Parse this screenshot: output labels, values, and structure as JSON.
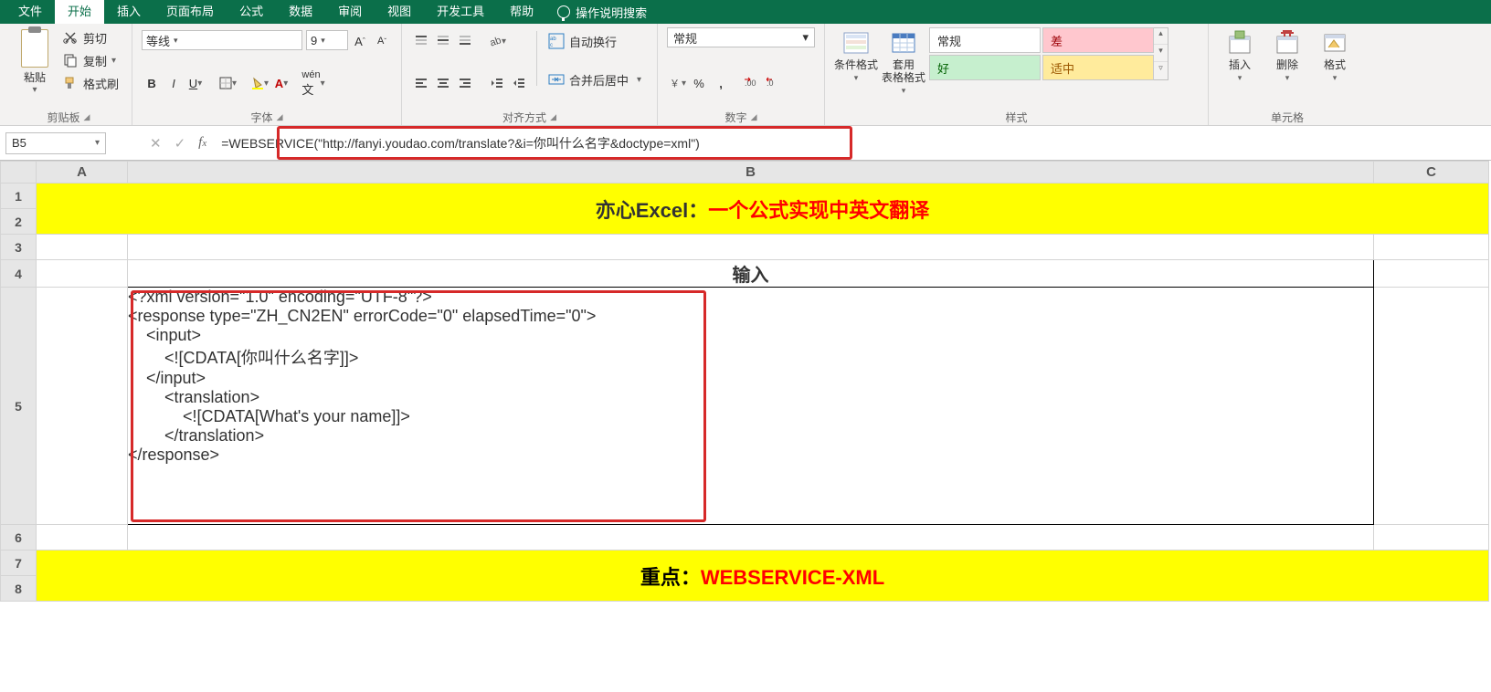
{
  "menu": {
    "items": [
      "文件",
      "开始",
      "插入",
      "页面布局",
      "公式",
      "数据",
      "审阅",
      "视图",
      "开发工具",
      "帮助"
    ],
    "active": 1,
    "tell_me": "操作说明搜索"
  },
  "ribbon": {
    "clipboard": {
      "paste": "粘贴",
      "cut": "剪切",
      "copy": "复制",
      "format_painter": "格式刷",
      "caption": "剪贴板"
    },
    "font": {
      "name": "等线",
      "size": "9",
      "caption": "字体"
    },
    "alignment": {
      "wrap": "自动换行",
      "merge": "合并后居中",
      "caption": "对齐方式"
    },
    "number": {
      "format": "常规",
      "caption": "数字"
    },
    "styles": {
      "cond": "条件格式",
      "table": "套用\n表格格式",
      "normal": "常规",
      "bad": "差",
      "good": "好",
      "neutral": "适中",
      "caption": "样式"
    },
    "cells": {
      "insert": "插入",
      "delete": "删除",
      "format": "格式",
      "caption": "单元格"
    }
  },
  "formula_bar": {
    "name": "B5",
    "formula": "=WEBSERVICE(\"http://fanyi.youdao.com/translate?&i=你叫什么名字&doctype=xml\")"
  },
  "columns": [
    "A",
    "B",
    "C"
  ],
  "rows": [
    "1",
    "2",
    "3",
    "4",
    "5",
    "6",
    "7",
    "8"
  ],
  "sheet": {
    "title_prefix": "亦心Excel：",
    "title_red": "一个公式实现中英文翻译",
    "header_b4": "输入",
    "xml_text": "<?xml version=\"1.0\" encoding=\"UTF-8\"?>\n<response type=\"ZH_CN2EN\" errorCode=\"0\" elapsedTime=\"0\">\n    <input>\n        <![CDATA[你叫什么名字]]>\n    </input>\n        <translation>\n            <![CDATA[What's your name]]>\n        </translation>\n</response>",
    "bottom_prefix": "重点：",
    "bottom_red": "WEBSERVICE-XML"
  }
}
